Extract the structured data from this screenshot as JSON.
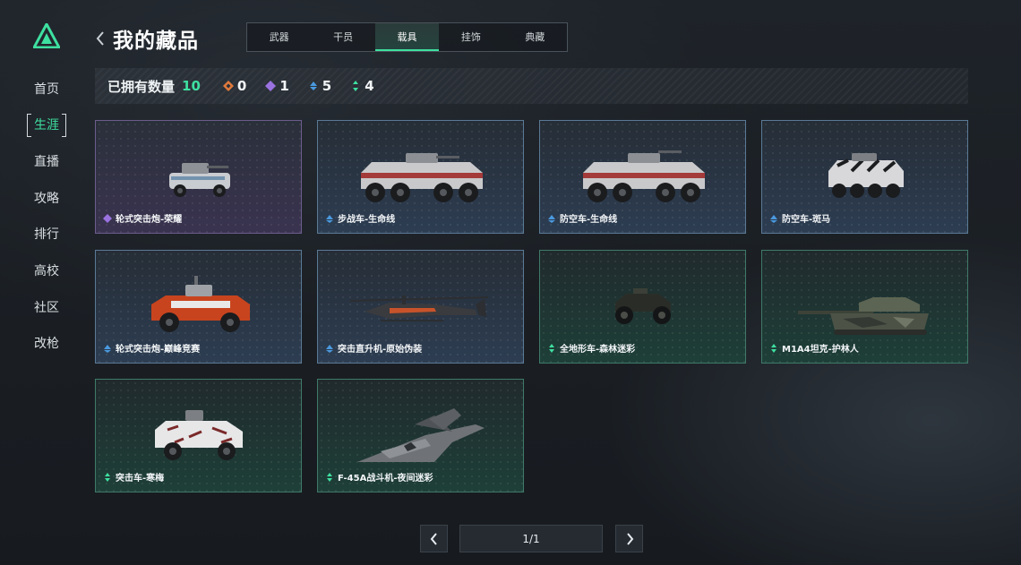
{
  "app": {
    "logo": "logo-triangle-icon"
  },
  "nav": {
    "items": [
      {
        "label": "首页",
        "active": false
      },
      {
        "label": "生涯",
        "active": true
      },
      {
        "label": "直播",
        "active": false
      },
      {
        "label": "攻略",
        "active": false
      },
      {
        "label": "排行",
        "active": false
      },
      {
        "label": "高校",
        "active": false
      },
      {
        "label": "社区",
        "active": false
      },
      {
        "label": "改枪",
        "active": false
      }
    ]
  },
  "header": {
    "back_icon": "chevron-left-icon",
    "title": "我的藏品",
    "tabs": [
      {
        "label": "武器",
        "active": false
      },
      {
        "label": "干员",
        "active": false
      },
      {
        "label": "载具",
        "active": true
      },
      {
        "label": "挂饰",
        "active": false
      },
      {
        "label": "典藏",
        "active": false
      }
    ]
  },
  "summary": {
    "label": "已拥有数量",
    "total": "10",
    "rarities": [
      {
        "name": "orange",
        "color": "#e07a3c",
        "count": "0"
      },
      {
        "name": "purple",
        "color": "#9a72e0",
        "count": "1"
      },
      {
        "name": "blue",
        "color": "#4a9ae0",
        "count": "5"
      },
      {
        "name": "green",
        "color": "#3ee0a0",
        "count": "4"
      }
    ]
  },
  "items": [
    {
      "name": "轮式突击炮-荣耀",
      "rarity": "purple",
      "vehicle": "wheeled-assault-gun-icon"
    },
    {
      "name": "步战车-生命线",
      "rarity": "blue",
      "vehicle": "infantry-fighting-vehicle-icon"
    },
    {
      "name": "防空车-生命线",
      "rarity": "blue",
      "vehicle": "anti-air-vehicle-icon"
    },
    {
      "name": "防空车-斑马",
      "rarity": "blue",
      "vehicle": "anti-air-vehicle-icon"
    },
    {
      "name": "轮式突击炮-巅峰竞赛",
      "rarity": "blue",
      "vehicle": "wheeled-assault-gun-icon"
    },
    {
      "name": "突击直升机-原始伪装",
      "rarity": "blue",
      "vehicle": "attack-helicopter-icon"
    },
    {
      "name": "全地形车-森林迷彩",
      "rarity": "green",
      "vehicle": "atv-icon"
    },
    {
      "name": "M1A4坦克-护林人",
      "rarity": "green",
      "vehicle": "tank-icon"
    },
    {
      "name": "突击车-寒梅",
      "rarity": "green",
      "vehicle": "assault-vehicle-icon"
    },
    {
      "name": "F-45A战斗机-夜间迷彩",
      "rarity": "green",
      "vehicle": "fighter-jet-icon"
    }
  ],
  "colors": {
    "accent": "#3ee0a0",
    "purple": "#9a72e0",
    "blue": "#4a9ae0",
    "green": "#3ee0a0",
    "orange": "#e07a3c"
  },
  "pagination": {
    "prev_icon": "chevron-left-icon",
    "next_icon": "chevron-right-icon",
    "text": "1/1"
  }
}
